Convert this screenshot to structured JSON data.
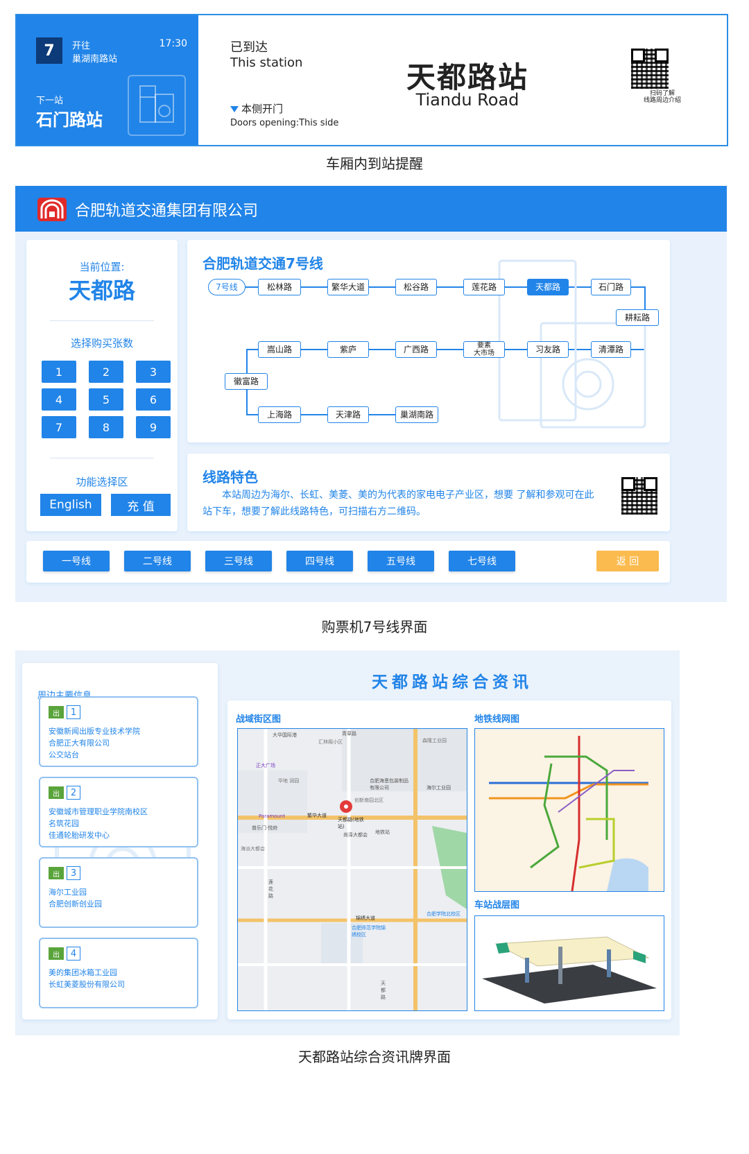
{
  "incar": {
    "line_number": "7",
    "towards_label": "开往",
    "towards_value": "巢湖南路站",
    "time": "17:30",
    "next_label": "下一站",
    "next_value": "石门路站",
    "arrived_cn": "已到达",
    "arrived_en": "This station",
    "door_cn": "本侧开门",
    "door_en": "Doors opening:This side",
    "station_cn": "天都路站",
    "station_en": "Tiandu Road",
    "qr_caption_1": "扫码了解",
    "qr_caption_2": "线路周边介绍"
  },
  "captions": {
    "c1": "车厢内到站提醒",
    "c2": "购票机7号线界面",
    "c3": "天都路站综合资讯牌界面"
  },
  "ticket": {
    "company": "合肥轨道交通集团有限公司",
    "current_label": "当前位置:",
    "current_value": "天都路",
    "qty_label": "选择购买张数",
    "numbers": [
      "1",
      "2",
      "3",
      "4",
      "5",
      "6",
      "7",
      "8",
      "9"
    ],
    "func_label": "功能选择区",
    "english_button": "English",
    "recharge_button": "充 值",
    "line_title": "合肥轨道交通7号线",
    "line_tag": "7号线",
    "stations": {
      "s1": "松林路",
      "s2": "繁华大道",
      "s3": "松谷路",
      "s4": "莲花路",
      "s5": "天都路",
      "s6": "石门路",
      "s7": "耕耘路",
      "s8": "嵩山路",
      "s9": "紫庐",
      "s10": "广西路",
      "s11a": "要素",
      "s11b": "大市场",
      "s12": "习友路",
      "s13": "清潭路",
      "s14": "徽富路",
      "s15": "上海路",
      "s16": "天津路",
      "s17": "巢湖南路"
    },
    "feature_title": "线路特色",
    "feature_text": "本站周边为海尔、长虹、美菱、美的为代表的家电电子产业区，想要 了解和参观可在此站下车，想要了解此线路特色，可扫描右方二维码。",
    "line_buttons": [
      "一号线",
      "二号线",
      "三号线",
      "四号线",
      "五号线",
      "七号线"
    ],
    "back_button": "返 回"
  },
  "infoboard": {
    "nearby_label": "周边主要信息",
    "exit_chip": "出",
    "exits": [
      {
        "num": "1",
        "places": [
          "安徽新闻出版专业技术学院",
          "合肥正大有限公司",
          "公交站台"
        ]
      },
      {
        "num": "2",
        "places": [
          "安徽城市管理职业学院南校区",
          "名筑花园",
          "佳通轮胎研发中心"
        ]
      },
      {
        "num": "3",
        "places": [
          "海尔工业园",
          "合肥创新创业园"
        ]
      },
      {
        "num": "4",
        "places": [
          "美的集团冰箱工业园",
          "长虹美菱股份有限公司"
        ]
      }
    ],
    "title": "天都路站综合资讯",
    "street_map_label": "战域街区图",
    "metro_map_label": "地铁线网图",
    "floor_label": "车站战层图",
    "map_text": {
      "street_1": "大华国际港",
      "street_2": "汇林阁小区",
      "street_3": "青草路",
      "street_4": "森隆工业园",
      "street_5": "正大广场",
      "street_6": "华地 润园",
      "street_7": "合肥海恩包装制品有限公司",
      "street_8": "海尔工业园",
      "street_9": "创新南园北区",
      "street_10": "Paramount",
      "street_11": "繁华大道",
      "street_12": "天都路(地铁站)",
      "street_13": "普乐门·悦府",
      "street_14": "尚泽大都会",
      "street_15": "地铁站",
      "street_16": "海派大都会",
      "street_17": "莲花路",
      "street_18": "锦绣大道",
      "street_19": "合肥师范学院锦绣校区",
      "street_20": "天都路",
      "street_21": "合肥学院北校区"
    }
  }
}
